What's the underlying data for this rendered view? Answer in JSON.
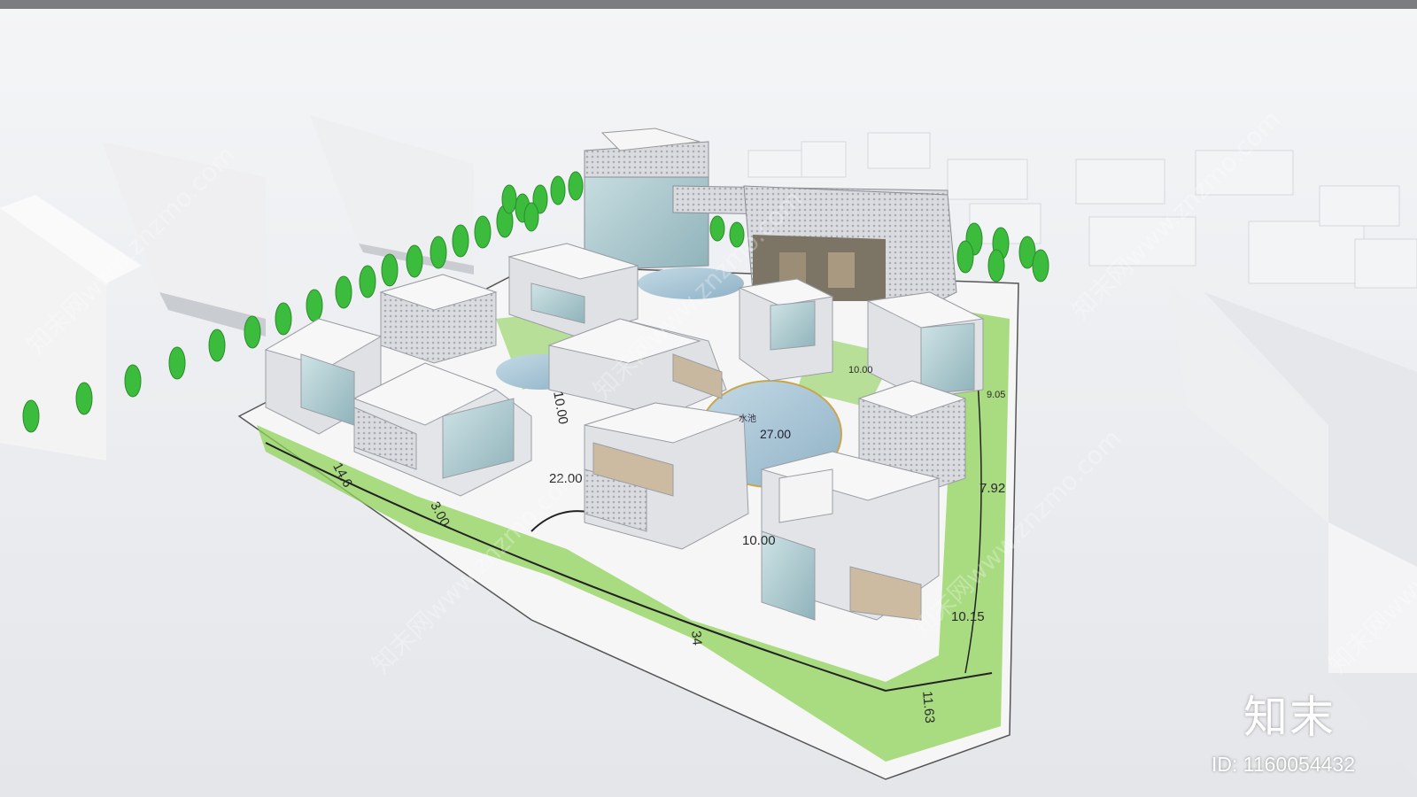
{
  "dimensions": [
    "14.6",
    "3.00",
    "22.00",
    "10.00",
    "27.00",
    "10.00",
    "10.00",
    "9.05",
    "7.92",
    "10.15",
    "11.63",
    "34"
  ],
  "pool_label": "水池",
  "watermark": {
    "logo": "知末",
    "id": "ID: 1160054432",
    "diagonal": "知末网www.znzmo.com"
  },
  "colors": {
    "ground": "#e9ebee",
    "grass": "#7cc44a",
    "tree": "#3cbc3c",
    "water": "#aac6d6"
  }
}
